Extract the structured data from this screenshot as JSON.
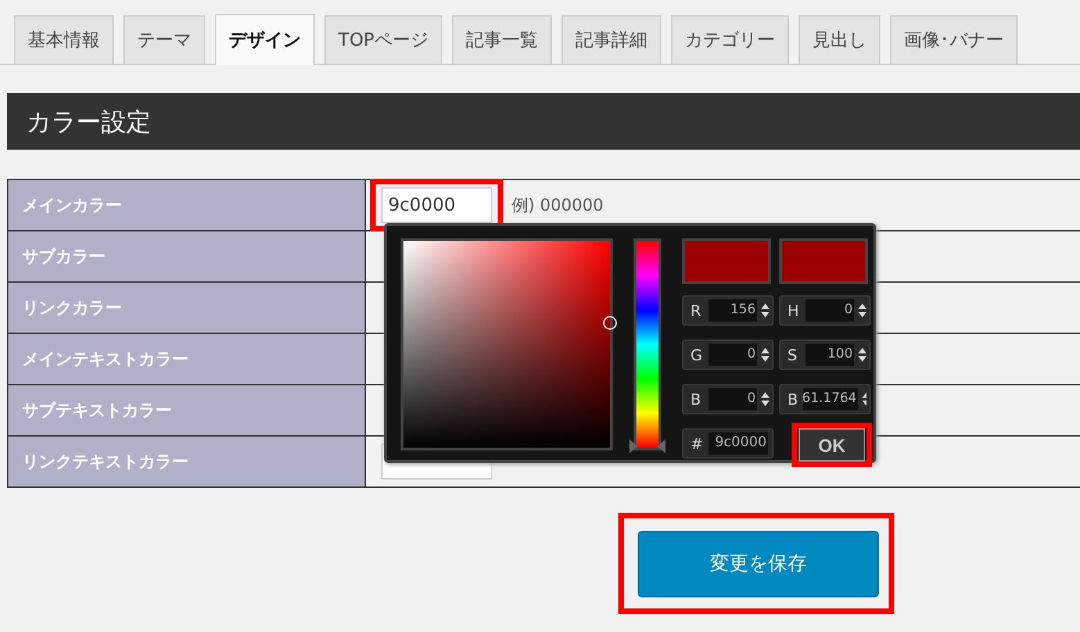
{
  "tabs": [
    {
      "label": "基本情報",
      "selected": false
    },
    {
      "label": "テーマ",
      "selected": false
    },
    {
      "label": "デザイン",
      "selected": true
    },
    {
      "label": "TOPページ",
      "selected": false
    },
    {
      "label": "記事一覧",
      "selected": false
    },
    {
      "label": "記事詳細",
      "selected": false
    },
    {
      "label": "カテゴリー",
      "selected": false
    },
    {
      "label": "見出し",
      "selected": false
    },
    {
      "label": "画像･バナー",
      "selected": false
    }
  ],
  "section_title": "カラー設定",
  "color_rows": [
    {
      "label": "メインカラー",
      "value": "9c0000",
      "example": "例) 000000",
      "highlighted": true
    },
    {
      "label": "サブカラー",
      "highlighted": false
    },
    {
      "label": "リンクカラー",
      "highlighted": false
    },
    {
      "label": "メインテキストカラー",
      "highlighted": false
    },
    {
      "label": "サブテキストカラー",
      "highlighted": false
    },
    {
      "label": "リンクテキストカラー",
      "highlighted": false
    }
  ],
  "color_picker": {
    "swatches": [
      {
        "color": "#9c0000"
      },
      {
        "color": "#9c0000"
      }
    ],
    "fields": [
      {
        "label": "R",
        "value": "156"
      },
      {
        "label": "H",
        "value": "0"
      },
      {
        "label": "G",
        "value": "0"
      },
      {
        "label": "S",
        "value": "100"
      },
      {
        "label": "B",
        "value": "0"
      },
      {
        "label": "B",
        "value": "61.1764"
      }
    ],
    "hue": {
      "level": 0
    },
    "hex_label": "#",
    "hex_value": "9c0000",
    "ok_label": "OK",
    "ok_highlighted": true
  },
  "save_button": {
    "label": "変更を保存",
    "highlighted": true
  }
}
